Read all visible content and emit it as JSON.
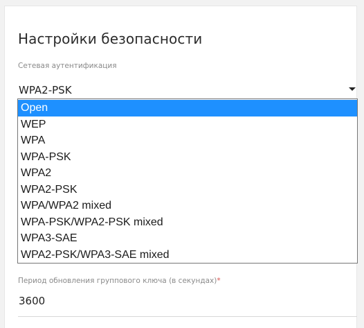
{
  "section": {
    "title": "Настройки безопасности"
  },
  "auth_field": {
    "label": "Сетевая аутентификация",
    "value": "WPA2-PSK",
    "options": [
      "Open",
      "WEP",
      "WPA",
      "WPA-PSK",
      "WPA2",
      "WPA2-PSK",
      "WPA/WPA2 mixed",
      "WPA-PSK/WPA2-PSK mixed",
      "WPA3-SAE",
      "WPA2-PSK/WPA3-SAE mixed"
    ],
    "highlighted_option": "Open"
  },
  "group_key_field": {
    "label": "Период обновления группового ключа (в секундах)",
    "required_mark": "*",
    "value": "3600"
  },
  "colors": {
    "highlight": "#1e90ff",
    "required": "#d9534f",
    "label": "#8a8a8a"
  },
  "icons": {
    "select_caret": "caret-down-icon"
  }
}
